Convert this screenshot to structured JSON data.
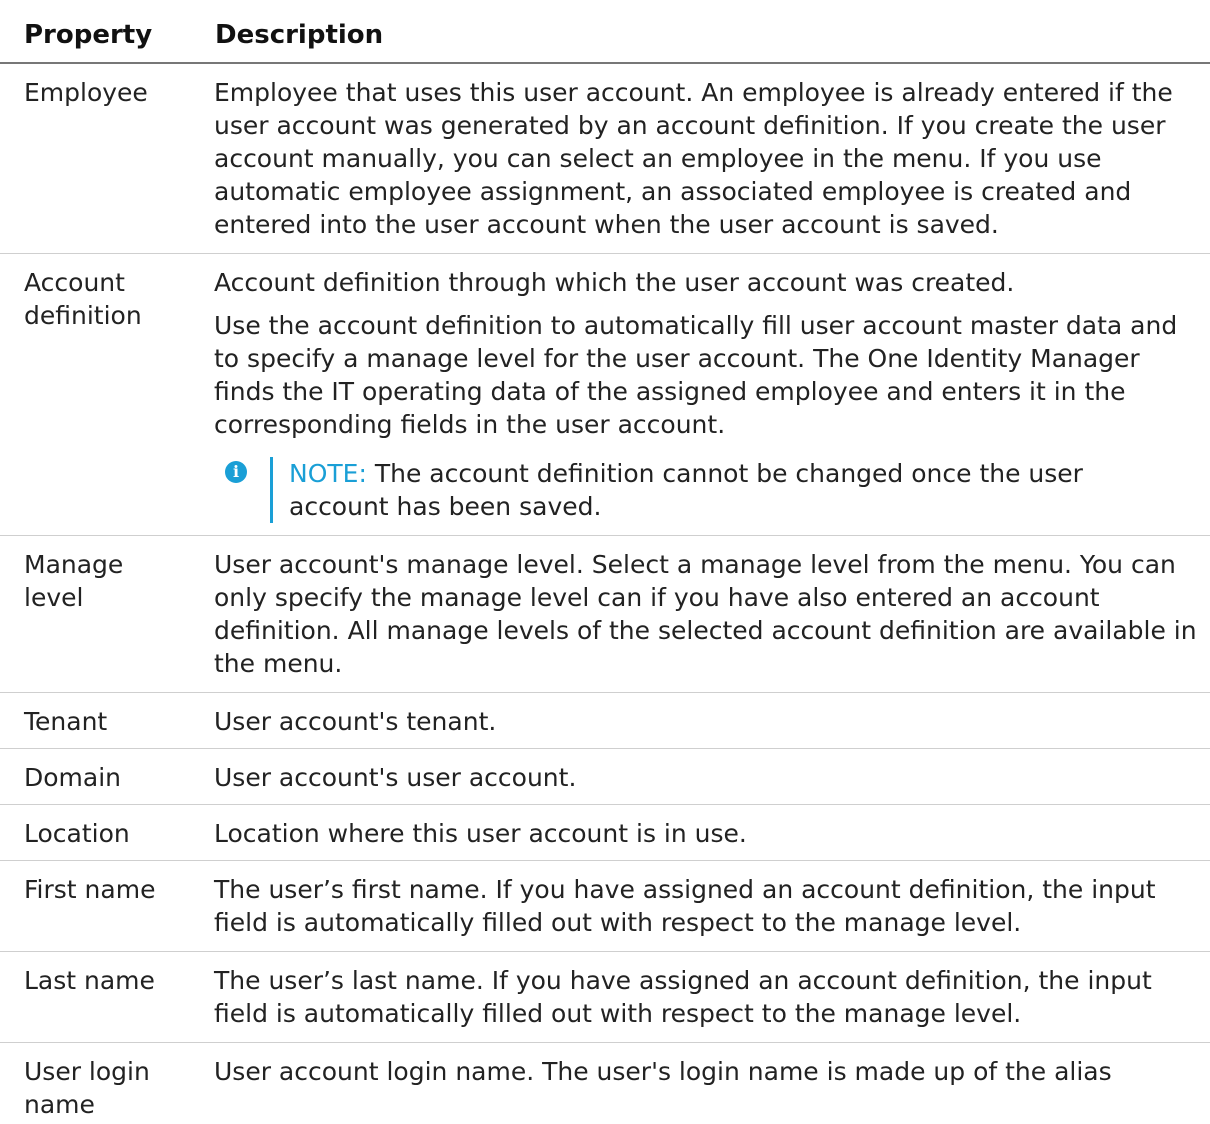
{
  "table": {
    "headers": {
      "property": "Property",
      "description": "Description"
    },
    "rows": [
      {
        "property": "Employee",
        "paragraphs": [
          "Employee that uses this user account. An employee is already entered if the user account was generated by an account definition. If you create the user account manually, you can select an employee in the menu. If you use automatic employee assignment, an associated employee is created and entered into the user account when the user account is saved."
        ]
      },
      {
        "property": "Account definition",
        "paragraphs": [
          "Account definition through which the user account was created.",
          "Use the account definition to automatically fill user account master data and to specify a manage level for the user account. The One Identity Manager finds the IT operating data of the assigned employee and enters it in the corresponding fields in the user account."
        ],
        "note": {
          "icon": "info-icon",
          "label": "NOTE:",
          "text": " The account definition cannot be changed once the user account has been saved."
        }
      },
      {
        "property": "Manage level",
        "paragraphs": [
          "User account's manage level. Select a manage level from the menu. You can only specify the manage level can if you have also entered an account definition. All manage levels of the selected account definition are available in the menu."
        ]
      },
      {
        "property": "Tenant",
        "paragraphs": [
          "User account's tenant."
        ]
      },
      {
        "property": "Domain",
        "paragraphs": [
          "User account's user account."
        ]
      },
      {
        "property": "Location",
        "paragraphs": [
          "Location where this user account is in use."
        ]
      },
      {
        "property": "First name",
        "paragraphs": [
          "The user’s first name. If you have assigned an account definition, the input field is automatically filled out with respect to the manage level."
        ]
      },
      {
        "property": "Last name",
        "paragraphs": [
          "The user’s last name. If you have assigned an account definition, the input field is automatically filled out with respect to the manage level."
        ]
      },
      {
        "property": "User login name",
        "paragraphs": [
          "User account login name. The user's login name is made up of the alias"
        ]
      }
    ]
  },
  "colors": {
    "note_accent": "#1a9fd6",
    "text": "#222222",
    "row_divider": "#cfcfcf"
  }
}
